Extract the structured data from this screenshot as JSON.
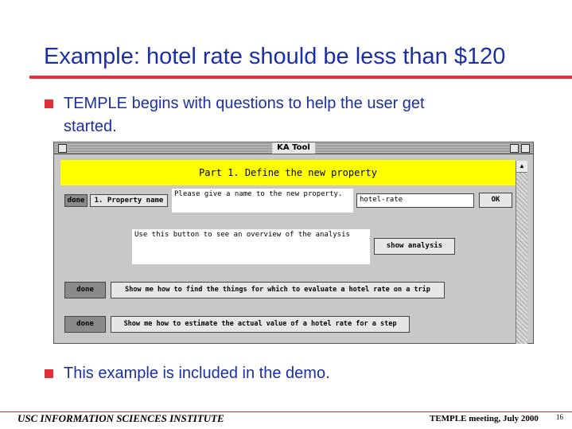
{
  "slide": {
    "title": "Example: hotel rate should be less than $120",
    "bullets": [
      {
        "line1": "TEMPLE begins with questions to help the user get",
        "line2": "started."
      },
      {
        "line1": "This example is included in the demo."
      }
    ],
    "accent_color": "#e0303a",
    "text_color": "#1a2fa8"
  },
  "window": {
    "title": "KA Tool",
    "header": "Part 1. Define the new property",
    "scroll_up_icon": "up-arrow-icon",
    "row1": {
      "done_label": "done",
      "property_button": "1. Property name",
      "prompt": "Please give a name to the new property.",
      "name_value": "hotel-rate",
      "ok_label": "OK"
    },
    "row2": {
      "prompt": "Use this button to see an overview of the analysis",
      "show_analysis_label": "show analysis"
    },
    "row3": {
      "done_label": "done",
      "task": "Show me how to find the things for which to evaluate a hotel rate on a trip"
    },
    "row4": {
      "done_label": "done",
      "task": "Show me how to estimate the actual value of a hotel rate for a step"
    }
  },
  "footer": {
    "left": "USC INFORMATION SCIENCES INSTITUTE",
    "right": "TEMPLE meeting, July 2000",
    "page": "16"
  }
}
